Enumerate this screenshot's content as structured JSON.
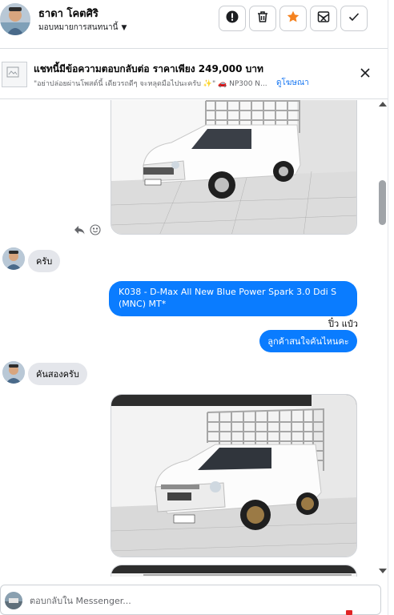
{
  "header": {
    "contact_name": "ธาดา โคตศิริ",
    "assign_label": "มอบหมายการสนทนานี้",
    "actions": [
      {
        "name": "report",
        "icon": "alert-circle-icon"
      },
      {
        "name": "delete",
        "icon": "trash-icon"
      },
      {
        "name": "star",
        "icon": "star-icon",
        "color": "#f5821f"
      },
      {
        "name": "spam",
        "icon": "spam-icon"
      },
      {
        "name": "done",
        "icon": "check-icon"
      }
    ]
  },
  "ad_notice": {
    "title": "แชทนี้มีข้อความตอบกลับต่อ ราคาเพียง 249,000 บาท",
    "subtitle": "\"อย่าปล่อยผ่านโพสต์นี้ เดียวรถดีๆ จะหลุดมือไปนะครับ ✨\" 🚗 NP300 N...",
    "link_label": "ดูโฆษณา"
  },
  "messages": [
    {
      "type": "photo",
      "direction": "incoming",
      "alt": "White Isuzu D-Max pickup with steel cage"
    },
    {
      "type": "text",
      "direction": "incoming",
      "text": "ครับ"
    },
    {
      "type": "text",
      "direction": "outgoing",
      "text": "K038 - D-Max All New Blue Power Spark 3.0 Ddi S (MNC) MT*"
    },
    {
      "type": "sender_label",
      "text": "ปิ๋ว แป๋ว"
    },
    {
      "type": "text",
      "direction": "outgoing",
      "text": "ลูกค้าสนใจคันไหนคะ"
    },
    {
      "type": "text",
      "direction": "incoming",
      "text": "คันสองครับ"
    },
    {
      "type": "photo",
      "direction": "incoming",
      "alt": "White Isuzu D-Max pickup with tall steel cage and bronze wheels"
    },
    {
      "type": "photo",
      "direction": "incoming",
      "alt": "Partial photo"
    }
  ],
  "composer": {
    "placeholder": "ตอบกลับใน Messenger..."
  },
  "colors": {
    "outgoing_bubble": "#0a7cff",
    "incoming_bubble": "#e4e6eb",
    "link": "#1877f2",
    "star": "#f5821f"
  }
}
